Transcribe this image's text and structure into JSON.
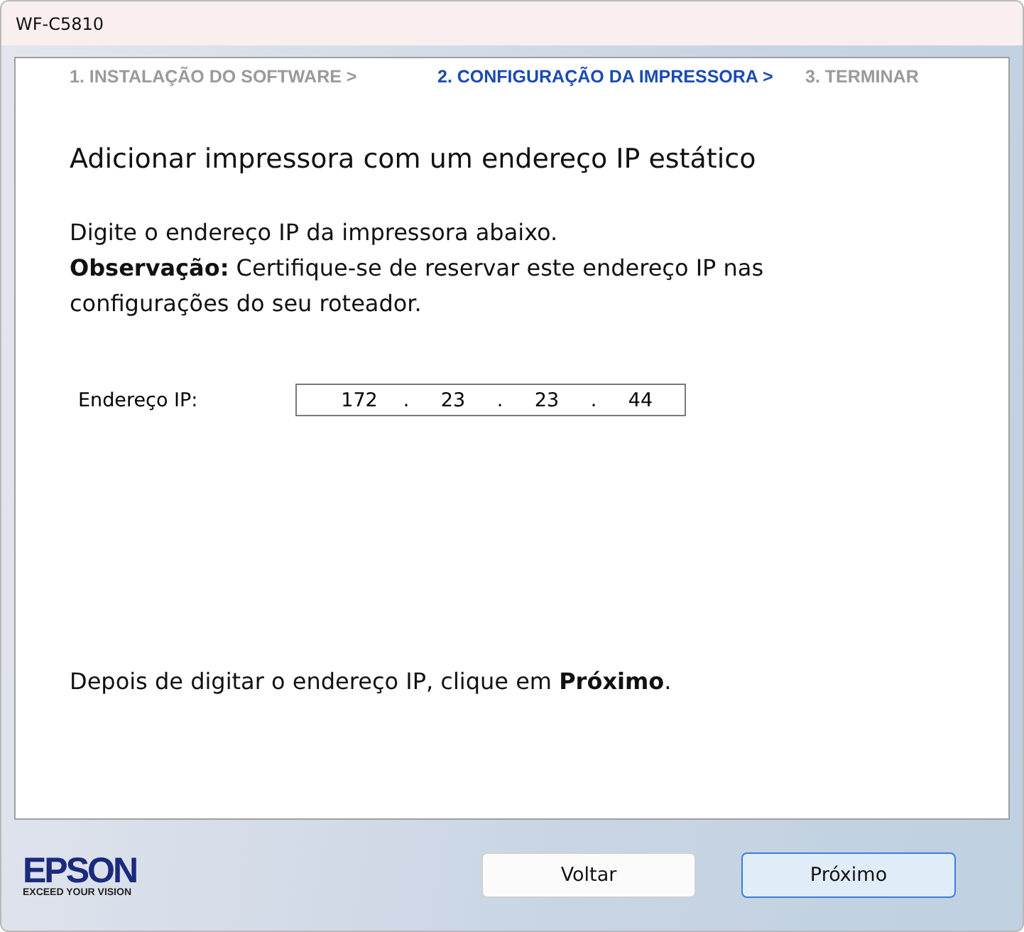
{
  "window": {
    "title": "WF-C5810"
  },
  "steps": [
    {
      "label": "1. INSTALAÇÃO DO SOFTWARE >",
      "selected": false
    },
    {
      "label": "2. CONFIGURAÇÃO DA IMPRESSORA >",
      "selected": true
    },
    {
      "label": "3. TERMINAR",
      "selected": false
    }
  ],
  "heading": "Adicionar impressora com um endereço IP estático",
  "instructions": [
    "Digite o endereço IP da impressora abaixo.",
    "**Observação:** Certifique-se de reservar este endereço IP nas configurações do seu roteador."
  ],
  "ip_field": {
    "label": "Endereço IP:",
    "octets": [
      "172",
      "23",
      "23",
      "44"
    ],
    "separator": "."
  },
  "hint": "Depois de digitar o endereço IP, clique em **Próximo**.",
  "logo": {
    "brand": "EPSON",
    "tagline": "EXCEED YOUR VISION"
  },
  "buttons": [
    {
      "label": "Voltar",
      "default": false
    },
    {
      "label": "Próximo",
      "default": true
    }
  ]
}
